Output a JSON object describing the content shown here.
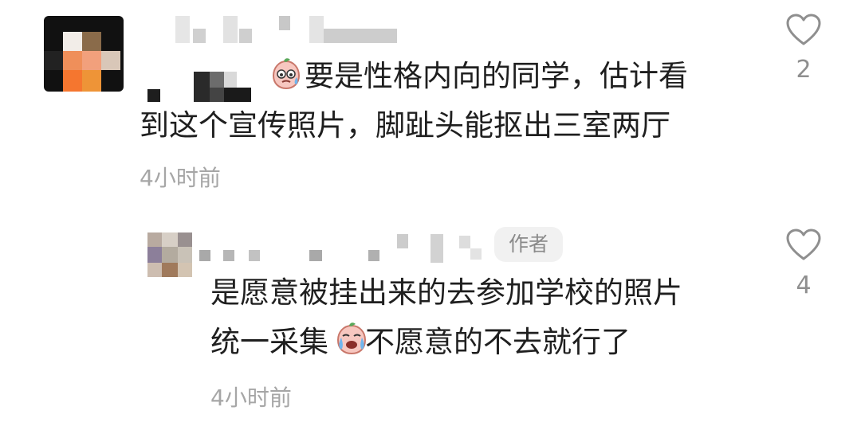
{
  "comments": [
    {
      "text_line1": "要是性格内向的同学，估计看",
      "text_line2": "到这个宣传照片，脚趾头能抠出三室两厅",
      "time": "4小时前",
      "likes": "2",
      "emoji_icon": "sweat-smile-face-icon"
    },
    {
      "author_badge": "作者",
      "text_line1": "是愿意被挂出来的去参加学校的照片",
      "text_line2_before": "统一采集",
      "text_line2_after": "不愿意的不去就行了",
      "time": "4小时前",
      "likes": "4",
      "emoji_icon": "crying-face-icon"
    }
  ],
  "colors": {
    "text": "#1f1f1f",
    "muted": "#a6a6a6",
    "badge_bg": "#f1f1f1",
    "icon": "#8f8f8f",
    "avatar_orange": "#f08a3c"
  }
}
